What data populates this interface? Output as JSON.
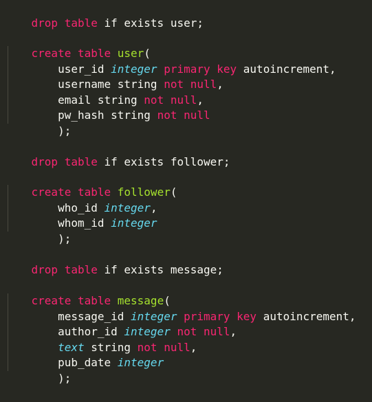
{
  "colors": {
    "background": "#272822",
    "keyword": "#f92672",
    "table_name": "#a6e22e",
    "type": "#66d9ef",
    "text": "#f8f8f2",
    "indent_guide": "#4a4a40"
  },
  "code": {
    "drop_user": {
      "kw": "drop table",
      "rest": " if exists user;"
    },
    "create_user": {
      "kw": "create table",
      "name": "user",
      "paren": "("
    },
    "user_lines": [
      {
        "indent": "    ",
        "col": "user_id ",
        "type": "integer",
        "kw": " primary key",
        "tail": " autoincrement,"
      },
      {
        "indent": "    ",
        "col": "username string ",
        "kw": "not null",
        "tail": ","
      },
      {
        "indent": "    ",
        "col": "email string ",
        "kw": "not null",
        "tail": ","
      },
      {
        "indent": "    ",
        "col": "pw_hash string ",
        "kw": "not null",
        "tail": ""
      }
    ],
    "close_user": "    );",
    "drop_follower": {
      "kw": "drop table",
      "rest": " if exists follower;"
    },
    "create_follower": {
      "kw": "create table",
      "name": "follower",
      "paren": "("
    },
    "follower_lines": [
      {
        "indent": "    ",
        "col": "who_id ",
        "type": "integer",
        "tail": ","
      },
      {
        "indent": "    ",
        "col": "whom_id ",
        "type": "integer",
        "tail": ""
      }
    ],
    "close_follower": "    );",
    "drop_message": {
      "kw": "drop table",
      "rest": " if exists message;"
    },
    "create_message": {
      "kw": "create table",
      "name": "message",
      "paren": "("
    },
    "message_lines": [
      {
        "indent": "    ",
        "col": "message_id ",
        "type": "integer",
        "kw": " primary key",
        "tail": " autoincrement,"
      },
      {
        "indent": "    ",
        "col": "author_id ",
        "type": "integer",
        "kw": " not null",
        "tail": ","
      },
      {
        "indent": "    ",
        "type_first": "text",
        "col": " string ",
        "kw": "not null",
        "tail": ","
      },
      {
        "indent": "    ",
        "col": "pub_date ",
        "type": "integer",
        "tail": ""
      }
    ],
    "close_message": "    );"
  }
}
